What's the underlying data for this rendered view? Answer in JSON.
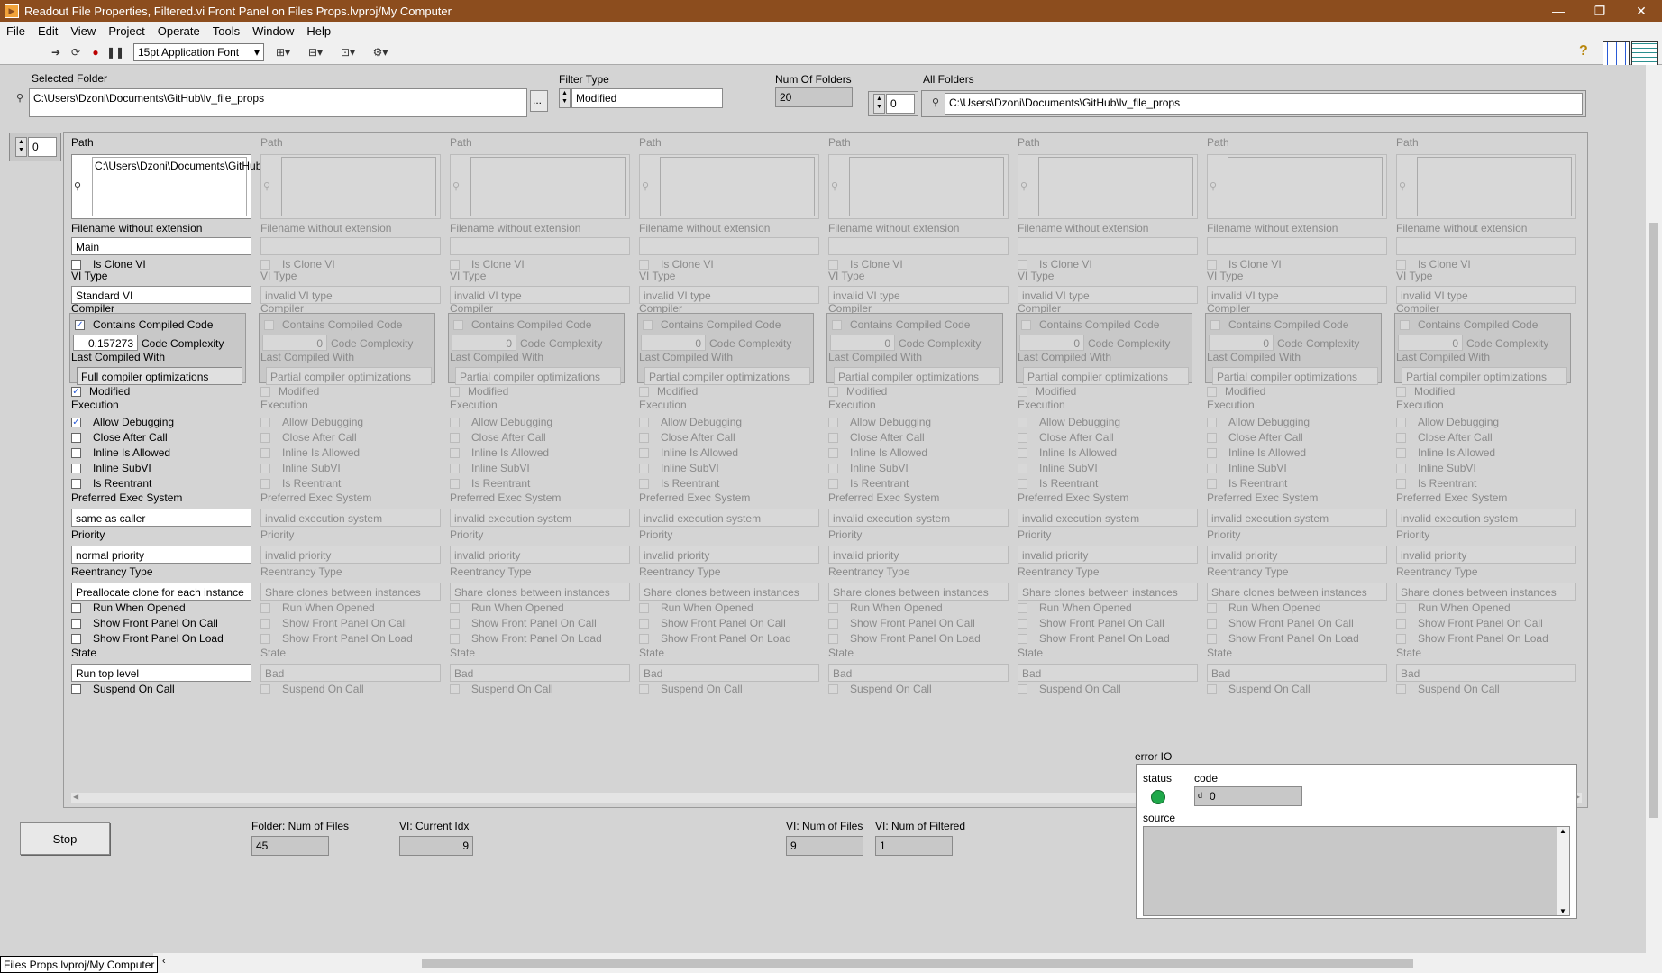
{
  "window": {
    "title": "Readout File Properties, Filtered.vi Front Panel on Files Props.lvproj/My Computer"
  },
  "menu": [
    "File",
    "Edit",
    "View",
    "Project",
    "Operate",
    "Tools",
    "Window",
    "Help"
  ],
  "toolbar": {
    "font": "15pt Application Font"
  },
  "controls": {
    "selected_folder_label": "Selected Folder",
    "selected_folder_value": "C:\\Users\\Dzoni\\Documents\\GitHub\\lv_file_props",
    "browse_label": "...",
    "filter_type_label": "Filter Type",
    "filter_type_value": "Modified",
    "num_folders_label": "Num Of Folders",
    "num_folders_value": "20",
    "all_folders_label": "All Folders",
    "all_folders_index": "0",
    "all_folders_value": "C:\\Users\\Dzoni\\Documents\\GitHub\\lv_file_props",
    "array_index": "0"
  },
  "labels": {
    "path": "Path",
    "filename": "Filename without extension",
    "is_clone": "Is Clone VI",
    "vi_type": "VI Type",
    "compiler": "Compiler",
    "contains_compiled": "Contains Compiled Code",
    "code_complexity": "Code Complexity",
    "last_compiled": "Last Compiled With",
    "modified": "Modified",
    "execution": "Execution",
    "allow_debugging": "Allow Debugging",
    "close_after_call": "Close After Call",
    "inline_allowed": "Inline Is Allowed",
    "inline_subvi": "Inline SubVI",
    "is_reentrant": "Is Reentrant",
    "pref_exec": "Preferred Exec System",
    "priority": "Priority",
    "reentrancy": "Reentrancy Type",
    "run_when_opened": "Run When Opened",
    "show_fp_call": "Show Front Panel On Call",
    "show_fp_load": "Show Front Panel On Load",
    "state": "State",
    "suspend_on_call": "Suspend On Call"
  },
  "elements": [
    {
      "path": "C:\\Users\\Dzoni\\Documents\\GitHub\\lv_file_props\\Main.vi",
      "filename": "Main",
      "is_clone": false,
      "vi_type": "Standard VI",
      "contains_compiled": true,
      "complexity": "0.157273",
      "last_compiled": "Full compiler optimizations",
      "modified": true,
      "allow_debugging": true,
      "close_after_call": false,
      "inline_allowed": false,
      "inline_subvi": false,
      "is_reentrant": false,
      "pref_exec": "same as caller",
      "priority": "normal priority",
      "reentrancy": "Preallocate clone for each instance",
      "run_when_opened": false,
      "show_fp_call": false,
      "show_fp_load": false,
      "state": "Run top level",
      "suspend_on_call": false
    },
    {
      "path": "",
      "filename": "",
      "vi_type": "invalid VI type",
      "complexity": "0",
      "last_compiled": "Partial compiler optimizations",
      "pref_exec": "invalid execution system",
      "priority": "invalid priority",
      "reentrancy": "Share clones between instances",
      "state": "Bad"
    },
    {
      "path": "",
      "filename": "",
      "vi_type": "invalid VI type",
      "complexity": "0",
      "last_compiled": "Partial compiler optimizations",
      "pref_exec": "invalid execution system",
      "priority": "invalid priority",
      "reentrancy": "Share clones between instances",
      "state": "Bad"
    },
    {
      "path": "",
      "filename": "",
      "vi_type": "invalid VI type",
      "complexity": "0",
      "last_compiled": "Partial compiler optimizations",
      "pref_exec": "invalid execution system",
      "priority": "invalid priority",
      "reentrancy": "Share clones between instances",
      "state": "Bad"
    },
    {
      "path": "",
      "filename": "",
      "vi_type": "invalid VI type",
      "complexity": "0",
      "last_compiled": "Partial compiler optimizations",
      "pref_exec": "invalid execution system",
      "priority": "invalid priority",
      "reentrancy": "Share clones between instances",
      "state": "Bad"
    },
    {
      "path": "",
      "filename": "",
      "vi_type": "invalid VI type",
      "complexity": "0",
      "last_compiled": "Partial compiler optimizations",
      "pref_exec": "invalid execution system",
      "priority": "invalid priority",
      "reentrancy": "Share clones between instances",
      "state": "Bad"
    },
    {
      "path": "",
      "filename": "",
      "vi_type": "invalid VI type",
      "complexity": "0",
      "last_compiled": "Partial compiler optimizations",
      "pref_exec": "invalid execution system",
      "priority": "invalid priority",
      "reentrancy": "Share clones between instances",
      "state": "Bad"
    },
    {
      "path": "",
      "filename": "",
      "vi_type": "invalid VI type",
      "complexity": "0",
      "last_compiled": "Partial compiler optimizations",
      "pref_exec": "invalid execution system",
      "priority": "invalid priority",
      "reentrancy": "Share clones between instances",
      "state": "Bad"
    }
  ],
  "bottom": {
    "stop": "Stop",
    "folder_num_files_label": "Folder: Num of Files",
    "folder_num_files": "45",
    "current_idx_label": "VI: Current Idx",
    "current_idx": "9",
    "vi_num_files_label": "VI: Num of Files",
    "vi_num_files": "9",
    "vi_num_filtered_label": "VI: Num of Filtered",
    "vi_num_filtered": "1"
  },
  "error": {
    "label": "error IO",
    "status_label": "status",
    "code_label": "code",
    "code": "0",
    "code_radix": "d",
    "source_label": "source",
    "status_color": "#1fa84a"
  },
  "statusbar": "Files Props.lvproj/My Computer"
}
